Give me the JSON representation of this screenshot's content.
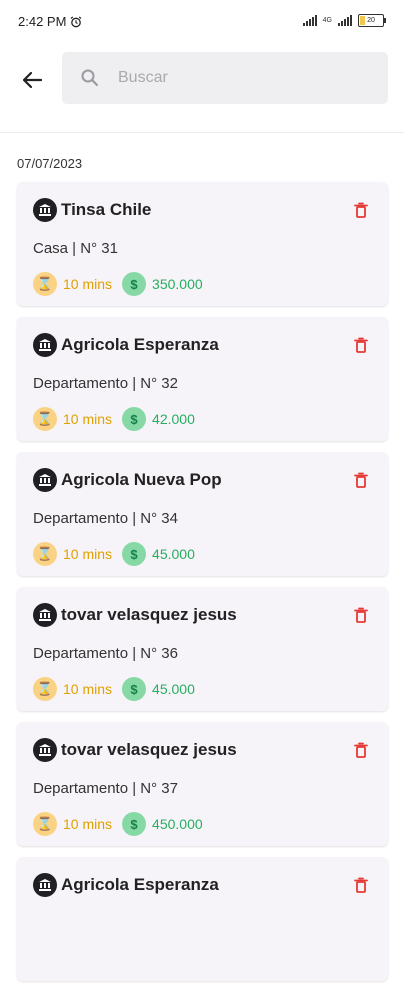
{
  "status": {
    "time": "2:42 PM",
    "network": "4G",
    "battery": "20"
  },
  "search": {
    "placeholder": "Buscar"
  },
  "date": "07/07/2023",
  "items": [
    {
      "title": "Tinsa Chile",
      "subtitle": "Casa | N° 31",
      "time": "10 mins",
      "amount": "350.000"
    },
    {
      "title": "Agricola Esperanza",
      "subtitle": "Departamento | N° 32",
      "time": "10 mins",
      "amount": "42.000"
    },
    {
      "title": "Agricola Nueva Pop",
      "subtitle": "Departamento | N° 34",
      "time": "10 mins",
      "amount": "45.000"
    },
    {
      "title": "tovar velasquez jesus",
      "subtitle": "Departamento | N° 36",
      "time": "10 mins",
      "amount": "45.000"
    },
    {
      "title": "tovar velasquez jesus",
      "subtitle": "Departamento | N° 37",
      "time": "10 mins",
      "amount": "450.000"
    },
    {
      "title": "Agricola Esperanza",
      "subtitle": "",
      "time": "",
      "amount": ""
    }
  ],
  "icons": {
    "hourglass": "⌛",
    "dollar": "$"
  },
  "colors": {
    "delete": "#e53935",
    "time": "#e0a000",
    "money": "#27ae60"
  }
}
